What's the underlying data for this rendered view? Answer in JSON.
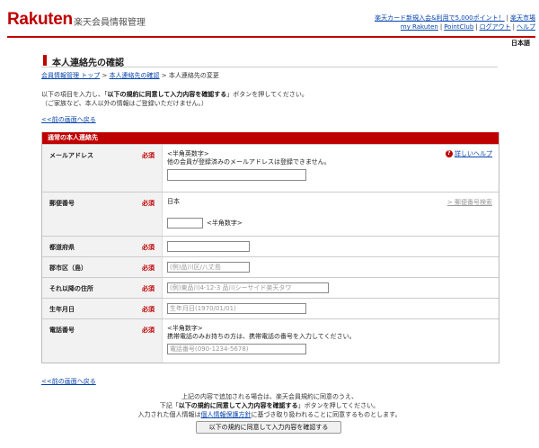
{
  "header": {
    "logo": "Rakuten",
    "site_title": "楽天会員情報管理",
    "promo_link": "楽天カード新規入会&利用で5,000ポイント！",
    "links_line1_extra": "楽天市場",
    "links_line2": [
      "my Rakuten",
      "PointClub",
      "ログアウト",
      "ヘルプ"
    ],
    "language": "日本語"
  },
  "page": {
    "title": "本人連絡先の確認",
    "breadcrumb": [
      "会員情報管理 トップ",
      "本人連絡先の確認",
      "本人連絡先の変更"
    ],
    "intro_pre": "以下の項目を入力し、「",
    "intro_bold": "以下の規約に同意して入力内容を確認する",
    "intro_post": "」ボタンを押してください。",
    "intro_line2": "（ご家族など、本人以外の情報はご登録いただけません。）",
    "back_link": "<<前の画面へ戻る"
  },
  "form": {
    "section_title": "通常の本人連絡先",
    "required_label": "必須",
    "email": {
      "label": "メールアドレス",
      "note1": "<半角英数字>",
      "note2": "他の会員が登録済みのメールアドレスは登録できません。",
      "help": "詳しいヘルプ",
      "value": ""
    },
    "zip": {
      "label": "郵便番号",
      "country": "日本",
      "search_link": "> 郵便番号検索",
      "hint": "<半角数字>",
      "value": ""
    },
    "prefecture": {
      "label": "都道府県",
      "value": ""
    },
    "city": {
      "label": "郡市区（島）",
      "placeholder": "(例)品川区/八丈島"
    },
    "address": {
      "label": "それ以降の住所",
      "placeholder": "(例)東品川4-12-3 品川シーサイド楽天タワ"
    },
    "birthday": {
      "label": "生年月日",
      "placeholder": "生年月日(1970/01/01)"
    },
    "phone": {
      "label": "電話番号",
      "note1": "<半角数字>",
      "note2": "携帯電話のみお持ちの方は、携帯電話の番号を入力してください。",
      "placeholder": "電話番号(090-1234-5678)"
    }
  },
  "footer": {
    "line1": "上記の内容で追加される場合は、楽天会員規約に同意のうえ、",
    "line2_pre": "下記「",
    "line2_bold": "以下の規約に同意して入力内容を確認する",
    "line2_post": "」ボタンを押してください。",
    "line3_pre": "入力された個人情報は",
    "line3_link": "個人情報保護方針",
    "line3_post": "に基づき取り扱われることに同意するものとします。",
    "submit_label": "以下の規約に同意して入力内容を確認する"
  }
}
